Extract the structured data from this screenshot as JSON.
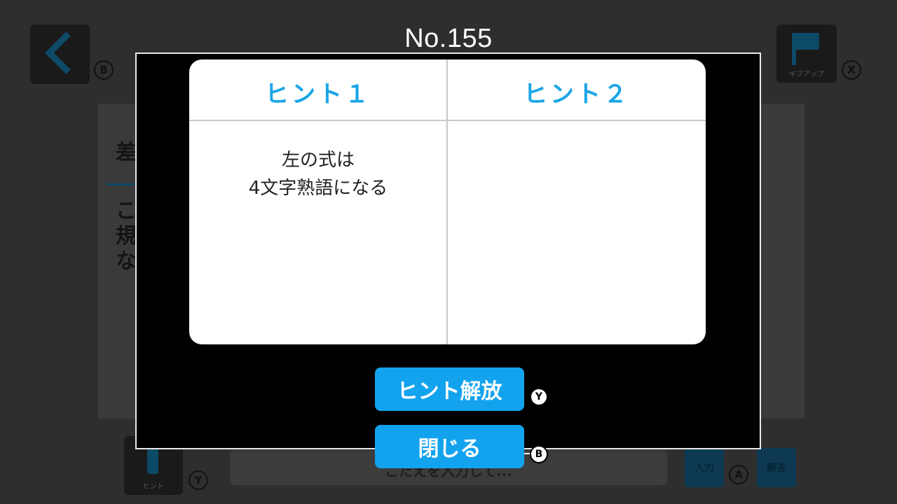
{
  "header": {
    "puzzle_number": "No.155"
  },
  "background": {
    "back_badge": "B",
    "giveup_caption": "ギブアップ",
    "giveup_badge": "X",
    "question_title": "差",
    "question_text": "こ規な",
    "hint_caption": "ヒント",
    "hint_badge": "Y",
    "answer_placeholder": "こたえを入力して...",
    "input_label": "入力",
    "input_badge": "A",
    "submit_label": "解答"
  },
  "modal": {
    "hints": [
      {
        "title": "ヒント１",
        "lines": [
          "左の式は",
          "4文字熟語になる"
        ]
      },
      {
        "title": "ヒント２",
        "lines": []
      }
    ],
    "unlock_button": {
      "label": "ヒント解放",
      "badge": "Y"
    },
    "close_button": {
      "label": "閉じる",
      "badge": "B"
    }
  },
  "colors": {
    "accent": "#13a3ee",
    "hint_title": "#1aa6e6",
    "modal_bg": "#000000",
    "card_bg": "#ffffff",
    "dim_bg": "#2e2e2e"
  }
}
